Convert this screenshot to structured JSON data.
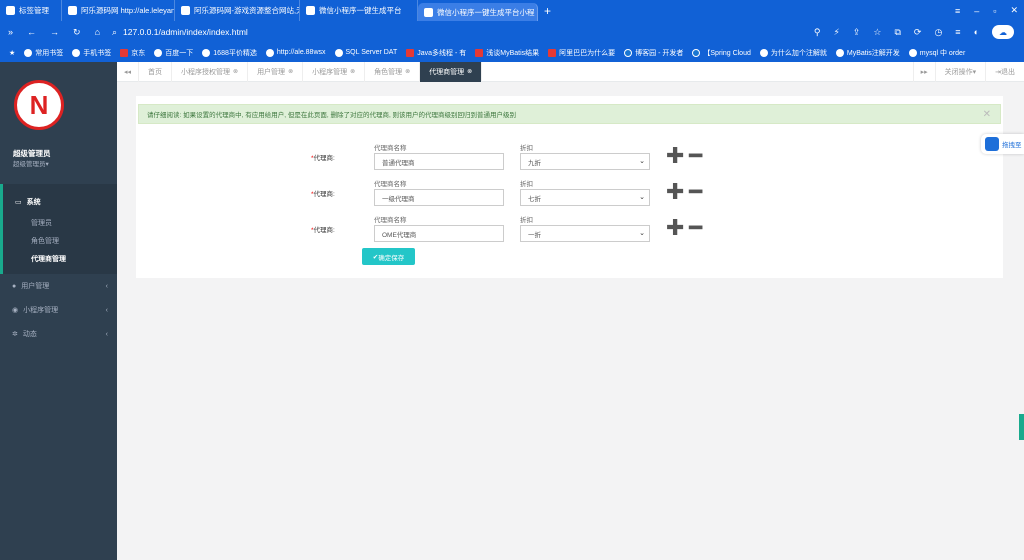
{
  "browser": {
    "tabs": [
      {
        "label": "标签管理"
      },
      {
        "label": "阿乐源码网 http://ale.leleyang"
      },
      {
        "label": "阿乐源码网-游戏资源整合网站,无"
      },
      {
        "label": "微信小程序一键生成平台"
      },
      {
        "label": "微信小程序一键生成平台小程",
        "active": true
      }
    ],
    "url": "127.0.0.1/admin/index/index.html",
    "bookmarks": [
      "常用书签",
      "手机书签",
      "京东",
      "百度一下",
      "1688平价精选",
      "http://ale.88wsx",
      "SQL Server DAT",
      "Java多线程 - 有",
      "浅谈MyBatis结果",
      "阿里巴巴为什么要",
      "博客园 - 开发者",
      "【Spring Cloud",
      "为什么加个注解就",
      "MyBatis注解开发",
      "mysql 中 order"
    ]
  },
  "sidebar": {
    "logo_letter": "N",
    "user_name": "超级管理员",
    "user_role": "超级管理员",
    "role_caret": "▾",
    "menu": {
      "system": {
        "label": "系统",
        "items": [
          "管理员",
          "角色管理",
          "代理商管理"
        ]
      },
      "user": {
        "label": "用户管理"
      },
      "miniapp": {
        "label": "小程序管理"
      },
      "news": {
        "label": "动态"
      }
    }
  },
  "content_tabs": {
    "tabs": [
      "首页",
      "小程序授权管理",
      "用户管理",
      "小程序管理",
      "角色管理",
      "代理商管理"
    ],
    "active_index": 5,
    "close_label": "关闭操作",
    "logout_label": "退出"
  },
  "page": {
    "notice": "请仔细阅读: 如果设置的代理商中, 有应用给用户, 但是在此页面, 删除了对应的代理商, 则该用户的代理商级别回归到普通用户级别",
    "field_label": "代理商:",
    "name_label": "代理商名称",
    "discount_label": "折扣",
    "rows": [
      {
        "name": "普通代理商",
        "discount": "九折"
      },
      {
        "name": "一级代理商",
        "discount": "七折"
      },
      {
        "name": "OME代理商",
        "discount": "一折"
      }
    ],
    "save_label": "确定保存",
    "float_label": "拖拽至"
  },
  "colors": {
    "accent": "#1161d6",
    "sidebar": "#2f4050",
    "save": "#23c6c8",
    "alert_bg": "#dff0d8"
  }
}
